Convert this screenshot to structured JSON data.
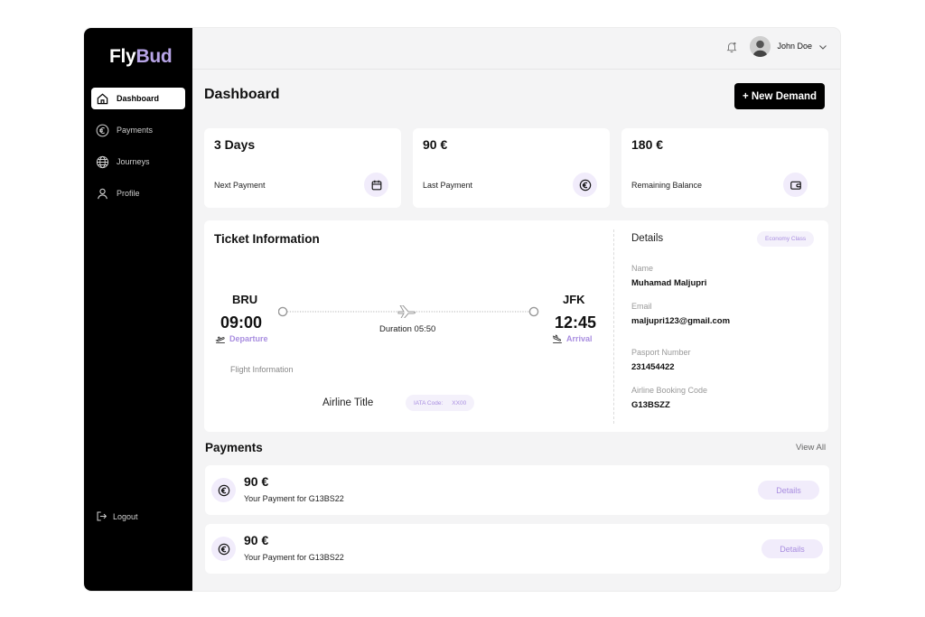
{
  "brand": {
    "part1": "Fly",
    "part2": "Bud"
  },
  "sidebar": {
    "items": [
      {
        "label": "Dashboard",
        "icon": "home-icon",
        "active": true
      },
      {
        "label": "Payments",
        "icon": "euro-icon",
        "active": false
      },
      {
        "label": "Journeys",
        "icon": "globe-icon",
        "active": false
      },
      {
        "label": "Profile",
        "icon": "user-icon",
        "active": false
      }
    ],
    "logout": "Logout"
  },
  "header": {
    "username": "John Doe"
  },
  "main": {
    "title": "Dashboard",
    "new_demand_label": "+ New Demand",
    "stats": [
      {
        "value": "3 Days",
        "label": "Next Payment",
        "icon": "calendar-icon"
      },
      {
        "value": "90 €",
        "label": "Last Payment",
        "icon": "euro-icon"
      },
      {
        "value": "180 €",
        "label": "Remaining Balance",
        "icon": "wallet-icon"
      }
    ]
  },
  "ticket": {
    "title": "Ticket Information",
    "from_code": "BRU",
    "from_time": "09:00",
    "from_label": "Departure",
    "to_code": "JFK",
    "to_time": "12:45",
    "to_label": "Arrival",
    "duration": "Duration 05:50",
    "flight_info_label": "Flight Information",
    "airline_title": "Airline Title",
    "iata_label": "IATA Code:",
    "iata_value": "XX00"
  },
  "details": {
    "title": "Details",
    "class_badge": "Economy Class",
    "name_label": "Name",
    "name_value": "Muhamad Maljupri",
    "email_label": "Email",
    "email_value": "maljupri123@gmail.com",
    "passport_label": "Pasport Number",
    "passport_value": "231454422",
    "booking_label": "Airline Booking Code",
    "booking_value": "G13BSZZ"
  },
  "payments": {
    "title": "Payments",
    "view_all": "View All",
    "items": [
      {
        "amount": "90 €",
        "description": "Your Payment for G13BS22",
        "details_label": "Details"
      },
      {
        "amount": "90 €",
        "description": "Your Payment for G13BS22",
        "details_label": "Details"
      }
    ]
  },
  "colors": {
    "accent": "#a98ee0",
    "accent_light": "#f1ecfb",
    "sidebar_bg": "#000000",
    "page_bg": "#f4f4f5"
  }
}
